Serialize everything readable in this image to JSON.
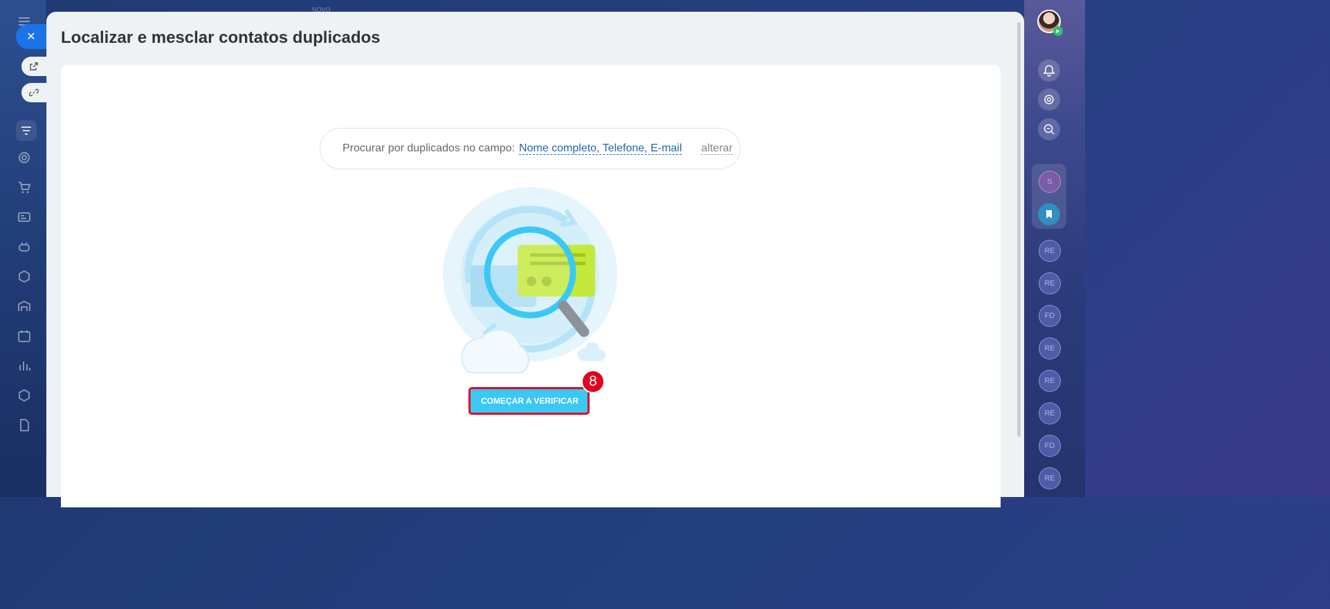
{
  "slider": {
    "title": "Localizar e mesclar contatos duplicados",
    "close_icon": "close-icon"
  },
  "background": {
    "top_label": "NOVO"
  },
  "search": {
    "label": "Procurar por duplicados no campo:",
    "fields_value": "Nome completo, Telefone, E-mail",
    "change_label": "alterar"
  },
  "actions": {
    "start_label": "COMEÇAR A VERIFICAR"
  },
  "annotation": {
    "step_number": "8",
    "color": "#e3001b"
  },
  "right_panel": {
    "chat_initials": [
      "S",
      "RE",
      "RE",
      "FD",
      "RE",
      "RE",
      "RE",
      "FD",
      "RE"
    ]
  },
  "colors": {
    "primary_button": "#3bc8f5",
    "link": "#2067b0"
  }
}
